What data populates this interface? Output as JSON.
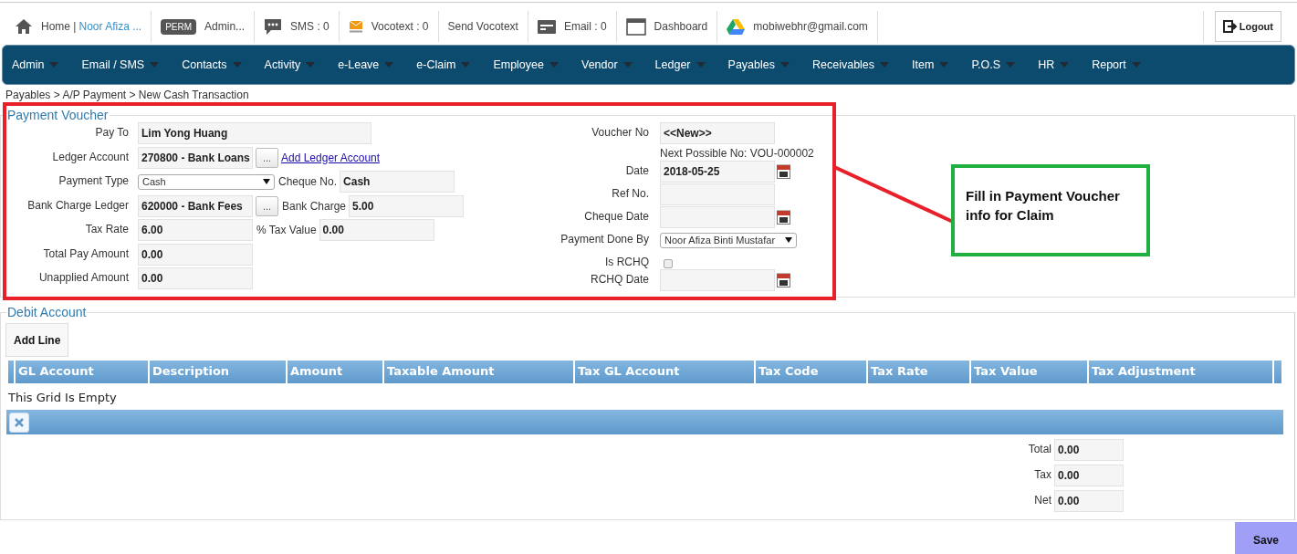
{
  "top_bar": {
    "items": [
      {
        "kind": "home",
        "text": "Home |",
        "link": "Noor Afiza ..."
      },
      {
        "kind": "perm",
        "badge": "PERM",
        "text": "Admin..."
      },
      {
        "kind": "sms",
        "text": "SMS : 0"
      },
      {
        "kind": "vocotext",
        "text": "Vocotext : 0"
      },
      {
        "kind": "plain",
        "text": "Send Vocotext"
      },
      {
        "kind": "email",
        "text": "Email : 0"
      },
      {
        "kind": "dashboard",
        "text": "Dashboard"
      },
      {
        "kind": "drive",
        "text": "mobiwebhr@gmail.com"
      }
    ],
    "logout": "Logout"
  },
  "nav": [
    "Admin",
    "Email / SMS",
    "Contacts",
    "Activity",
    "e-Leave",
    "e-Claim",
    "Employee",
    "Vendor",
    "Ledger",
    "Payables",
    "Receivables",
    "Item",
    "P.O.S",
    "HR",
    "Report"
  ],
  "breadcrumb": "Payables > A/P Payment > New Cash Transaction",
  "payment_voucher": {
    "title": "Payment Voucher",
    "left": [
      {
        "label": "Pay To",
        "controls": [
          {
            "kind": "wide_input",
            "value": "Lim Yong Huang"
          }
        ]
      },
      {
        "label": "Ledger Account",
        "controls": [
          {
            "kind": "input",
            "value": "270800 - Bank Loans"
          },
          {
            "kind": "button",
            "text": "..."
          },
          {
            "kind": "link",
            "text": "Add Ledger Account"
          }
        ]
      },
      {
        "label": "Payment Type",
        "controls": [
          {
            "kind": "select",
            "value": "Cash"
          },
          {
            "kind": "label",
            "text": "Cheque No."
          },
          {
            "kind": "input",
            "value": "Cash"
          }
        ]
      },
      {
        "label": "Bank Charge Ledger",
        "controls": [
          {
            "kind": "input",
            "value": "620000 - Bank Fees"
          },
          {
            "kind": "button",
            "text": "..."
          },
          {
            "kind": "label",
            "text": "Bank Charge"
          },
          {
            "kind": "input",
            "value": "5.00"
          }
        ]
      },
      {
        "label": "Tax Rate",
        "controls": [
          {
            "kind": "input",
            "value": "6.00"
          },
          {
            "kind": "label",
            "text": "% Tax Value"
          },
          {
            "kind": "input",
            "value": "0.00"
          }
        ]
      },
      {
        "label": "Total Pay Amount",
        "controls": [
          {
            "kind": "input",
            "value": "0.00"
          }
        ]
      },
      {
        "label": "Unapplied Amount",
        "controls": [
          {
            "kind": "input",
            "value": "0.00"
          }
        ]
      }
    ],
    "right": [
      {
        "label": "Voucher No",
        "kind": "input",
        "value": "<<New>>",
        "note": "Next Possible No: VOU-000002"
      },
      {
        "label": "Date",
        "kind": "date",
        "value": "2018-05-25"
      },
      {
        "label": "Ref No.",
        "kind": "input"
      },
      {
        "label": "Cheque Date",
        "kind": "date"
      },
      {
        "label": "Payment Done By",
        "kind": "select",
        "value": "Noor Afiza Binti Mustafar"
      },
      {
        "label": "Is RCHQ",
        "kind": "checkbox",
        "checked": false
      },
      {
        "label": "RCHQ Date",
        "kind": "date"
      }
    ]
  },
  "annotation": {
    "text": "Fill in Payment Voucher info for Claim"
  },
  "debit_account": {
    "title": "Debit Account",
    "add_button": "Add Line",
    "columns": [
      "GL Account",
      "Description",
      "Amount",
      "Taxable Amount",
      "Tax GL Account",
      "Tax Code",
      "Tax Rate",
      "Tax Value",
      "Tax Adjustment"
    ],
    "empty_text": "This Grid Is Empty",
    "totals": [
      {
        "label": "Total",
        "value": "0.00"
      },
      {
        "label": "Tax",
        "value": "0.00"
      },
      {
        "label": "Net",
        "value": "0.00"
      }
    ]
  },
  "save": "Save"
}
